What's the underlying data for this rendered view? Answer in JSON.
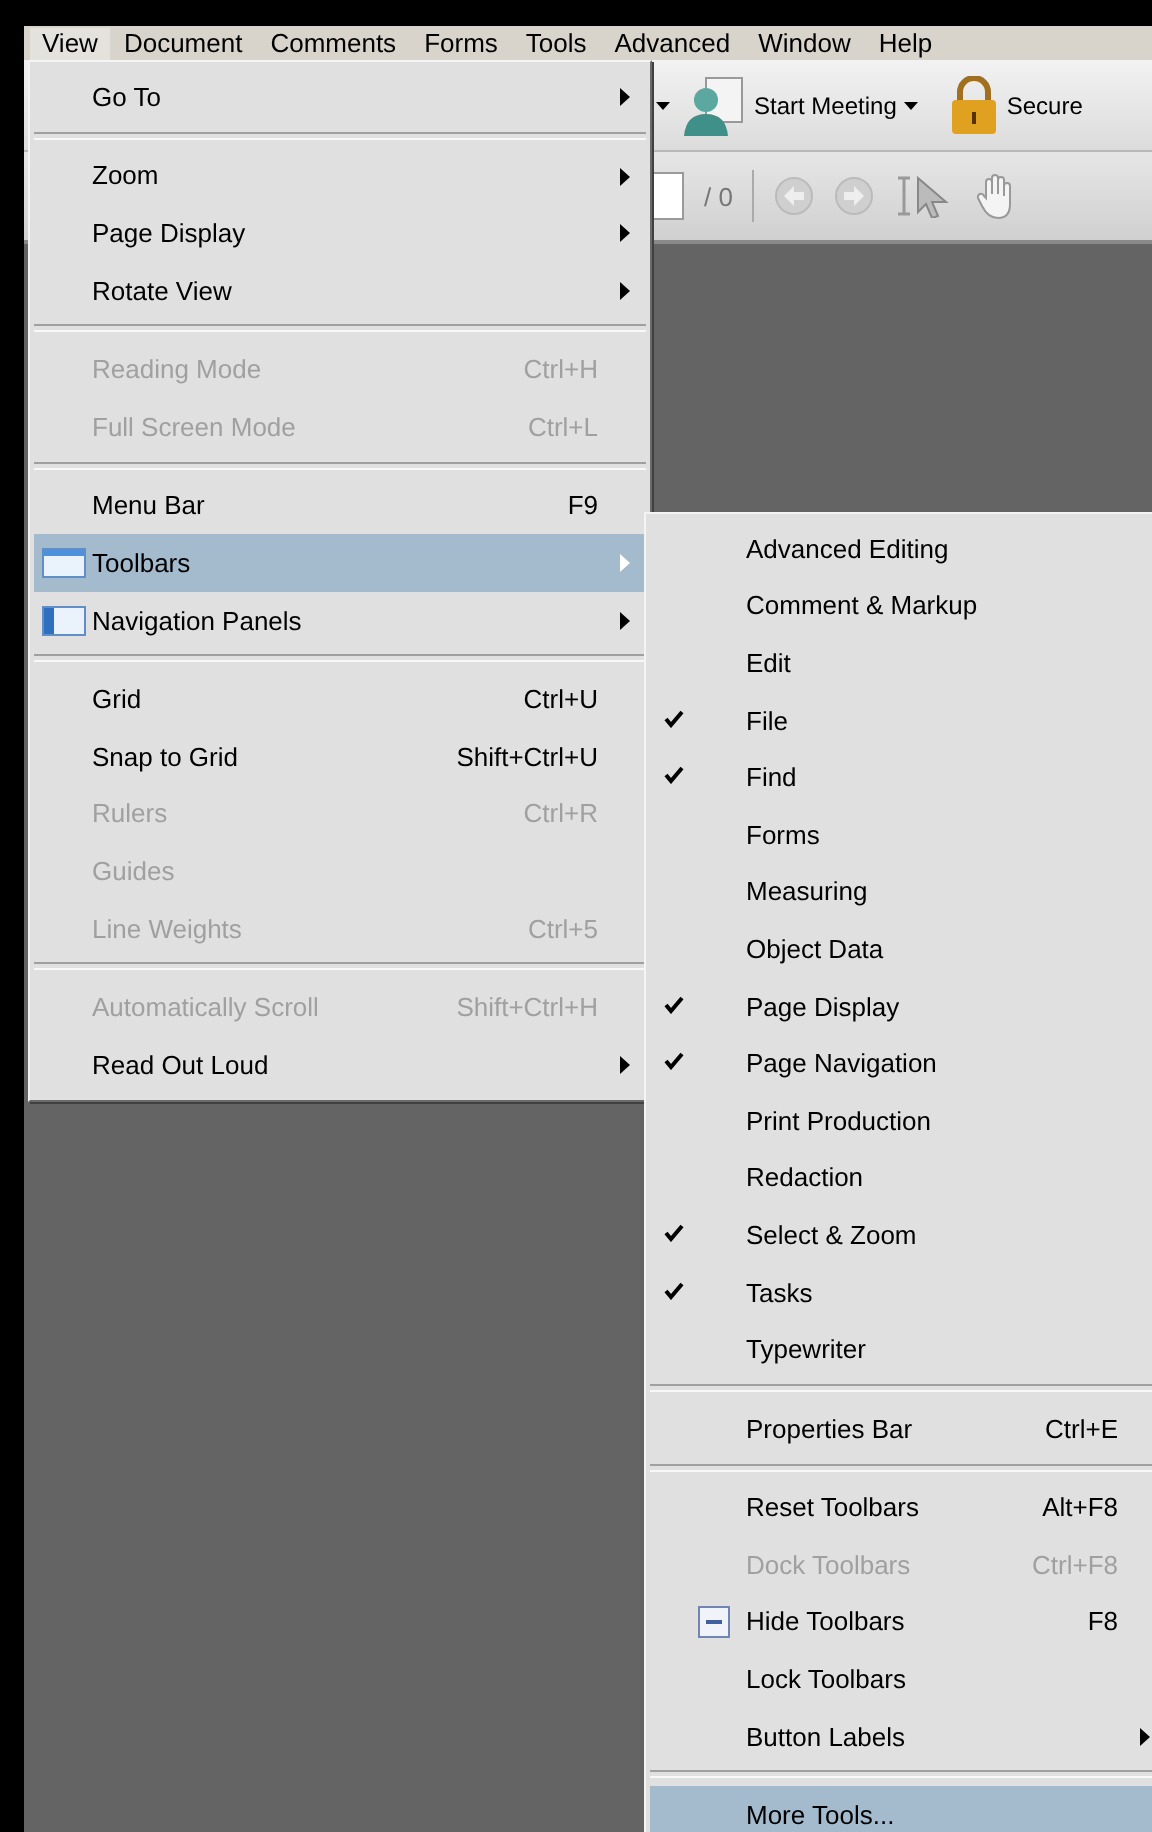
{
  "menu_bar": [
    {
      "label": "View",
      "selected": true
    },
    {
      "label": "Document",
      "selected": false
    },
    {
      "label": "Comments",
      "selected": false
    },
    {
      "label": "Forms",
      "selected": false
    },
    {
      "label": "Tools",
      "selected": false
    },
    {
      "label": "Advanced",
      "selected": false
    },
    {
      "label": "Window",
      "selected": false
    },
    {
      "label": "Help",
      "selected": false
    }
  ],
  "toolbar": {
    "meeting_button": "Start Meeting",
    "secure_button": "Secure",
    "page_count": "/ 0"
  },
  "view_menu": {
    "groups": [
      [
        {
          "label": "Go To",
          "has_submenu": true,
          "disabled": false,
          "selected": false,
          "kind": "plain"
        }
      ],
      [
        {
          "label": "Zoom",
          "has_submenu": true,
          "disabled": false,
          "selected": false,
          "kind": "plain"
        },
        {
          "label": "Page Display",
          "has_submenu": true,
          "disabled": false,
          "selected": false,
          "kind": "plain"
        },
        {
          "label": "Rotate View",
          "has_submenu": true,
          "disabled": false,
          "selected": false,
          "kind": "plain"
        }
      ],
      [
        {
          "label": "Reading Mode",
          "shortcut": "Ctrl+H",
          "has_submenu": false,
          "disabled": true,
          "selected": false,
          "kind": "plain"
        },
        {
          "label": "Full Screen Mode",
          "shortcut": "Ctrl+L",
          "has_submenu": false,
          "disabled": true,
          "selected": false,
          "kind": "plain"
        }
      ],
      [
        {
          "label": "Menu Bar",
          "shortcut": "F9",
          "has_submenu": false,
          "disabled": false,
          "selected": false,
          "kind": "plain"
        },
        {
          "label": "Toolbars",
          "has_submenu": true,
          "disabled": false,
          "selected": true,
          "kind": "toolbar_icon"
        },
        {
          "label": "Navigation Panels",
          "has_submenu": true,
          "disabled": false,
          "selected": false,
          "kind": "panel_icon"
        }
      ],
      [
        {
          "label": "Grid",
          "shortcut": "Ctrl+U",
          "has_submenu": false,
          "disabled": false,
          "selected": false,
          "kind": "plain"
        },
        {
          "label": "Snap to Grid",
          "shortcut": "Shift+Ctrl+U",
          "has_submenu": false,
          "disabled": false,
          "selected": false,
          "kind": "plain"
        },
        {
          "label": "Rulers",
          "shortcut": "Ctrl+R",
          "has_submenu": false,
          "disabled": true,
          "selected": false,
          "kind": "plain"
        },
        {
          "label": "Guides",
          "has_submenu": false,
          "disabled": true,
          "selected": false,
          "kind": "plain"
        },
        {
          "label": "Line Weights",
          "shortcut": "Ctrl+5",
          "has_submenu": false,
          "disabled": true,
          "selected": false,
          "kind": "plain"
        }
      ],
      [
        {
          "label": "Automatically Scroll",
          "shortcut": "Shift+Ctrl+H",
          "has_submenu": false,
          "disabled": true,
          "selected": false,
          "kind": "plain"
        },
        {
          "label": "Read Out Loud",
          "has_submenu": true,
          "disabled": false,
          "selected": false,
          "kind": "plain"
        }
      ]
    ]
  },
  "toolbars_submenu": {
    "groups": [
      [
        {
          "label": "Advanced Editing",
          "checked": false,
          "has_submenu": false,
          "disabled": false,
          "selected": false,
          "kind": "plain"
        },
        {
          "label": "Comment & Markup",
          "checked": false,
          "has_submenu": false,
          "disabled": false,
          "selected": false,
          "kind": "plain"
        },
        {
          "label": "Edit",
          "checked": false,
          "has_submenu": false,
          "disabled": false,
          "selected": false,
          "kind": "plain"
        },
        {
          "label": "File",
          "checked": true,
          "has_submenu": false,
          "disabled": false,
          "selected": false,
          "kind": "plain"
        },
        {
          "label": "Find",
          "checked": true,
          "has_submenu": false,
          "disabled": false,
          "selected": false,
          "kind": "plain"
        },
        {
          "label": "Forms",
          "checked": false,
          "has_submenu": false,
          "disabled": false,
          "selected": false,
          "kind": "plain"
        },
        {
          "label": "Measuring",
          "checked": false,
          "has_submenu": false,
          "disabled": false,
          "selected": false,
          "kind": "plain"
        },
        {
          "label": "Object Data",
          "checked": false,
          "has_submenu": false,
          "disabled": false,
          "selected": false,
          "kind": "plain"
        },
        {
          "label": "Page Display",
          "checked": true,
          "has_submenu": false,
          "disabled": false,
          "selected": false,
          "kind": "plain"
        },
        {
          "label": "Page Navigation",
          "checked": true,
          "has_submenu": false,
          "disabled": false,
          "selected": false,
          "kind": "plain"
        },
        {
          "label": "Print Production",
          "checked": false,
          "has_submenu": false,
          "disabled": false,
          "selected": false,
          "kind": "plain"
        },
        {
          "label": "Redaction",
          "checked": false,
          "has_submenu": false,
          "disabled": false,
          "selected": false,
          "kind": "plain"
        },
        {
          "label": "Select & Zoom",
          "checked": true,
          "has_submenu": false,
          "disabled": false,
          "selected": false,
          "kind": "plain"
        },
        {
          "label": "Tasks",
          "checked": true,
          "has_submenu": false,
          "disabled": false,
          "selected": false,
          "kind": "plain"
        },
        {
          "label": "Typewriter",
          "checked": false,
          "has_submenu": false,
          "disabled": false,
          "selected": false,
          "kind": "plain"
        }
      ],
      [
        {
          "label": "Properties Bar",
          "shortcut": "Ctrl+E",
          "checked": false,
          "has_submenu": false,
          "disabled": false,
          "selected": false,
          "kind": "plain"
        }
      ],
      [
        {
          "label": "Reset Toolbars",
          "shortcut": "Alt+F8",
          "checked": false,
          "has_submenu": false,
          "disabled": false,
          "selected": false,
          "kind": "plain"
        },
        {
          "label": "Dock Toolbars",
          "shortcut": "Ctrl+F8",
          "checked": false,
          "has_submenu": false,
          "disabled": true,
          "selected": false,
          "kind": "plain"
        },
        {
          "label": "Hide Toolbars",
          "shortcut": "F8",
          "checked": false,
          "has_submenu": false,
          "disabled": false,
          "selected": false,
          "kind": "hide_icon"
        },
        {
          "label": "Lock Toolbars",
          "checked": false,
          "has_submenu": false,
          "disabled": false,
          "selected": false,
          "kind": "plain"
        },
        {
          "label": "Button Labels",
          "checked": false,
          "has_submenu": true,
          "disabled": false,
          "selected": false,
          "kind": "plain"
        }
      ],
      [
        {
          "label": "More Tools...",
          "checked": false,
          "has_submenu": false,
          "disabled": false,
          "selected": true,
          "kind": "plain"
        }
      ]
    ]
  }
}
